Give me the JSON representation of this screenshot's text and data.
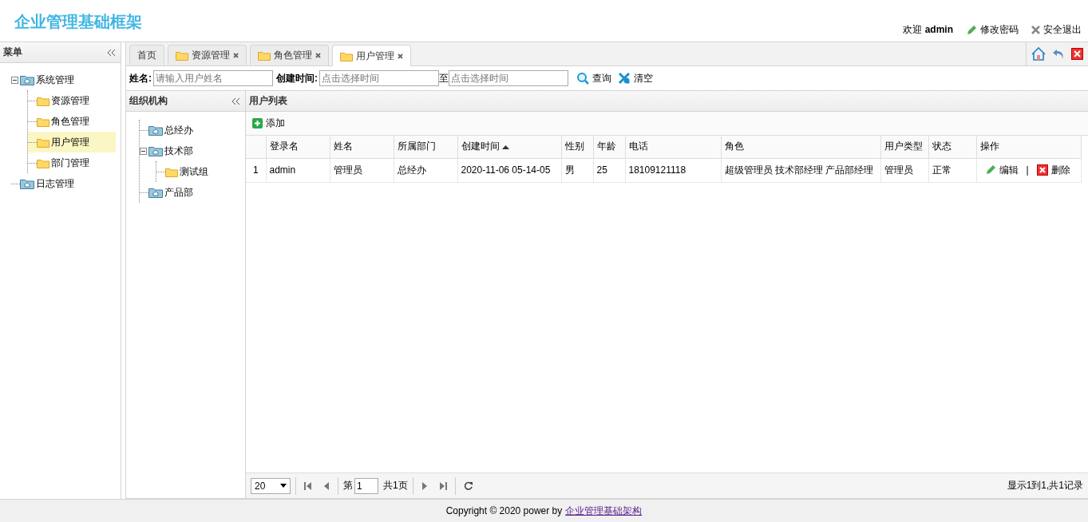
{
  "header": {
    "title": "企业管理基础框架",
    "welcome": "欢迎 **admin**",
    "links": [
      {
        "kind": "password",
        "label": "修改密码"
      },
      {
        "kind": "logout",
        "label": "安全退出"
      }
    ]
  },
  "menu": {
    "title": "菜单",
    "items": [
      {
        "label": "系统管理",
        "kind": "group",
        "expanded": true,
        "selected": false,
        "children": [
          {
            "label": "资源管理",
            "kind": "folder",
            "selected": false
          },
          {
            "label": "角色管理",
            "kind": "folder",
            "selected": false
          },
          {
            "label": "用户管理",
            "kind": "folder",
            "selected": true
          },
          {
            "label": "部门管理",
            "kind": "folder",
            "selected": false
          }
        ]
      },
      {
        "label": "日志管理",
        "kind": "group",
        "selected": false
      }
    ]
  },
  "tabs": [
    {
      "label": "首页",
      "kind": "home",
      "selected": false
    },
    {
      "label": "资源管理",
      "kind": "page",
      "selected": false
    },
    {
      "label": "角色管理",
      "kind": "page",
      "selected": false
    },
    {
      "label": "用户管理",
      "kind": "page",
      "selected": true
    }
  ],
  "search": {
    "name_label": "姓名:",
    "name_placeholder": "请输入用户姓名",
    "time_label": "创建时间:",
    "from_placeholder": "点击选择时间",
    "to_label": "至",
    "to_placeholder": "点击选择时间",
    "buttons": [
      {
        "kind": "search",
        "label": "查询"
      },
      {
        "kind": "clear",
        "label": "清空"
      }
    ]
  },
  "org": {
    "title": "组织机构",
    "items": [
      {
        "label": "总经办",
        "kind": "group"
      },
      {
        "label": "技术部",
        "kind": "group",
        "expanded": true,
        "children": [
          {
            "label": "测试组",
            "kind": "folder"
          }
        ]
      },
      {
        "label": "产品部",
        "kind": "group"
      }
    ]
  },
  "grid": {
    "title": "用户列表",
    "add_label": "添加",
    "columns": [
      {
        "label": "登录名"
      },
      {
        "label": "姓名"
      },
      {
        "label": "所属部门"
      },
      {
        "label": "创建时间",
        "sorted": true
      },
      {
        "label": "性别"
      },
      {
        "label": "年龄"
      },
      {
        "label": "电话"
      },
      {
        "label": "角色"
      },
      {
        "label": "用户类型"
      },
      {
        "label": "状态"
      },
      {
        "label": "操作"
      }
    ],
    "rows": [
      {
        "number": "1",
        "cells": [
          "admin",
          "管理员",
          "总经办",
          "2020-11-06 05-14-05",
          "男",
          "25",
          "18109121118",
          "超级管理员 技术部经理 产品部经理",
          "管理员",
          "正常"
        ],
        "actions": [
          {
            "kind": "edit",
            "label": "编辑"
          },
          {
            "kind": "delete",
            "label": "删除"
          }
        ],
        "separator": "|"
      }
    ]
  },
  "pager": {
    "page_size": "20",
    "before": "第",
    "page": "1",
    "after": "共1页",
    "summary": "显示1到1,共1记录"
  },
  "footer": {
    "text": "Copyright © 2020 power by",
    "link": "企业管理基础架构"
  }
}
